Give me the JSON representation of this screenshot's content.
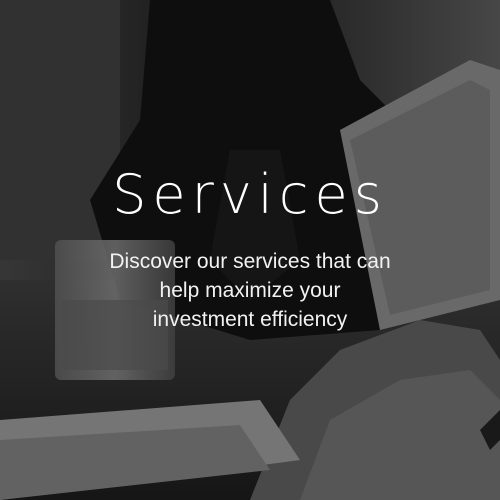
{
  "hero": {
    "title": "Services",
    "subtitle_lines": [
      "Discover our services that can",
      "help maximize your",
      "investment efficiency"
    ]
  },
  "colors": {
    "text": "#ffffff",
    "overlay": "#000000"
  }
}
